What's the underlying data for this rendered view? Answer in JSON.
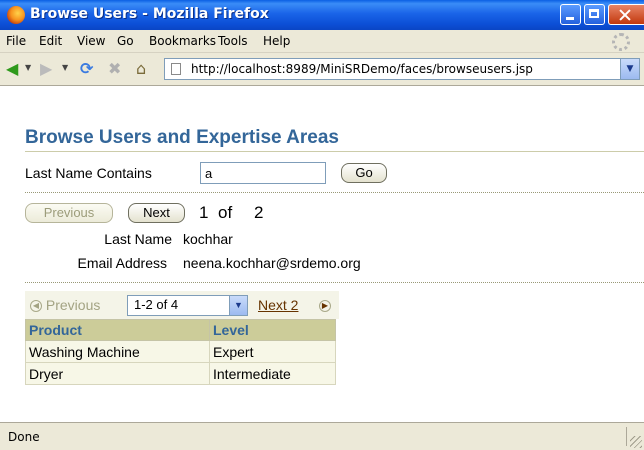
{
  "window": {
    "title": "Browse Users - Mozilla Firefox"
  },
  "menu": [
    "File",
    "Edit",
    "View",
    "Go",
    "Bookmarks",
    "Tools",
    "Help"
  ],
  "address": {
    "url": "http://localhost:8989/MiniSRDemo/faces/browseusers.jsp"
  },
  "page": {
    "title": "Browse Users and Expertise Areas",
    "search": {
      "label": "Last Name Contains",
      "value": "a",
      "go_label": "Go"
    },
    "pager": {
      "previous_label": "Previous",
      "next_label": "Next",
      "current": "1",
      "of_text": "of",
      "total": "2"
    },
    "details": {
      "last_name_label": "Last Name",
      "last_name_value": "kochhar",
      "email_label": "Email Address",
      "email_value": "neena.kochhar@srdemo.org"
    },
    "expertise": {
      "previous_label": "Previous",
      "range_selected": "1-2 of 4",
      "next_label": "Next 2",
      "columns": [
        "Product",
        "Level"
      ],
      "rows": [
        {
          "product": "Washing Machine",
          "level": "Expert"
        },
        {
          "product": "Dryer",
          "level": "Intermediate"
        }
      ]
    }
  },
  "status": {
    "text": "Done"
  }
}
